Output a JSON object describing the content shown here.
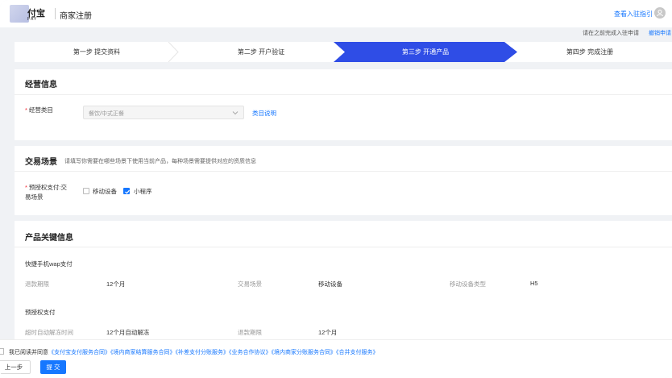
{
  "header": {
    "logo_text": "付宝",
    "logo_sub": "PAY",
    "title": "商家注册",
    "guide_link": "查看入驻指引",
    "note": "请在之前完成入驻申请",
    "revoke_link": "撤销申请"
  },
  "steps": [
    {
      "label": "第一步 提交资料"
    },
    {
      "label": "第二步 开户验证"
    },
    {
      "label": "第三步 开通产品"
    },
    {
      "label": "第四步 完成注册"
    }
  ],
  "business": {
    "title": "经营信息",
    "category_label": "经营类目",
    "category_value": "餐饮/中式正餐",
    "category_help": "类目说明"
  },
  "scene": {
    "title": "交易场景",
    "subtitle": "请填写你需要在哪些场景下使用当前产品，每种场景需要提供对应的资质信息",
    "field_label_1": "预授权支付:交",
    "field_label_2": "易场景",
    "options": [
      {
        "label": "移动设备",
        "checked": false
      },
      {
        "label": "小程序",
        "checked": true
      }
    ]
  },
  "product": {
    "title": "产品关键信息",
    "group1": {
      "name": "快捷手机wap支付",
      "items": [
        {
          "k": "退款期限",
          "v": "12个月"
        },
        {
          "k": "交易场景",
          "v": "移动设备"
        },
        {
          "k": "移动设备类型",
          "v": "H5"
        }
      ]
    },
    "group2": {
      "name": "预授权支付",
      "items": [
        {
          "k": "超时自动解冻时间",
          "v": "12个月自动解冻"
        },
        {
          "k": "退款期限",
          "v": "12个月"
        }
      ]
    }
  },
  "footer": {
    "agree_prefix": "我已阅读并同意",
    "agreements": [
      "《支付宝支付服务合同》",
      "《境内商家结算服务合同》",
      "《补差支付分账服务》",
      "《业务合作协议》",
      "《境内商家分账服务合同》",
      "《合并支付服务》"
    ],
    "prev_label": "上一步",
    "submit_label": "提 交"
  },
  "colors": {
    "accent": "#1677ff",
    "active_step": "#2f4de6",
    "background": "#f0f2f5"
  }
}
